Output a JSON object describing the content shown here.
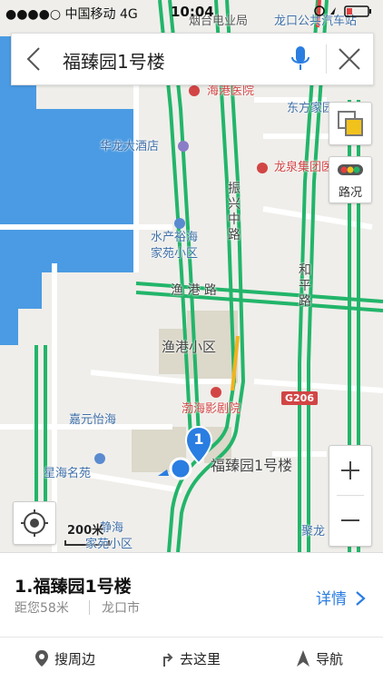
{
  "status_bar": {
    "signal": "●●●●○",
    "carrier": "中国移动",
    "network": "4G",
    "time": "10:04"
  },
  "search": {
    "query": "福臻园1号楼"
  },
  "map": {
    "labels": {
      "tobacco_bureau": "烟台电业局",
      "bus_station": "龙口公共汽车站",
      "haigang_hospital": "海港医院",
      "dongfang_home": "东方家园",
      "hualong_hotel": "华龙大酒店",
      "longquan_group": "龙泉集团医院",
      "shuiqi_1": "水产裕海",
      "shuiqi_2": "家苑小区",
      "yugang_road": "渔  港  路",
      "yugang_community": "渔港小区",
      "bohai_cinema": "渤海影剧院",
      "g206": "G206",
      "jiayuan": "嘉元怡海",
      "xinghai": "星海名苑",
      "jinghai": "静海",
      "jiayuan_xiaoqu": "家苑小区",
      "fuzhen": "福臻园1号楼",
      "julong": "聚龙",
      "marker_number": "1",
      "traffic_label": "路况",
      "scale": "200米"
    },
    "vertical_roads": {
      "zhenxing": [
        "振",
        "兴",
        "中",
        "路"
      ],
      "heping": [
        "和",
        "平",
        "路"
      ]
    }
  },
  "result": {
    "title": "1.福臻园1号楼",
    "distance": "距您58米",
    "city": "龙口市",
    "detail": "详情"
  },
  "actions": {
    "nearby": "搜周边",
    "go_here": "去这里",
    "navigate": "导航"
  },
  "colors": {
    "water": "#4a9be3",
    "road_green": "#22b56a",
    "accent": "#2a7de1",
    "marker": "#2a7de1"
  }
}
